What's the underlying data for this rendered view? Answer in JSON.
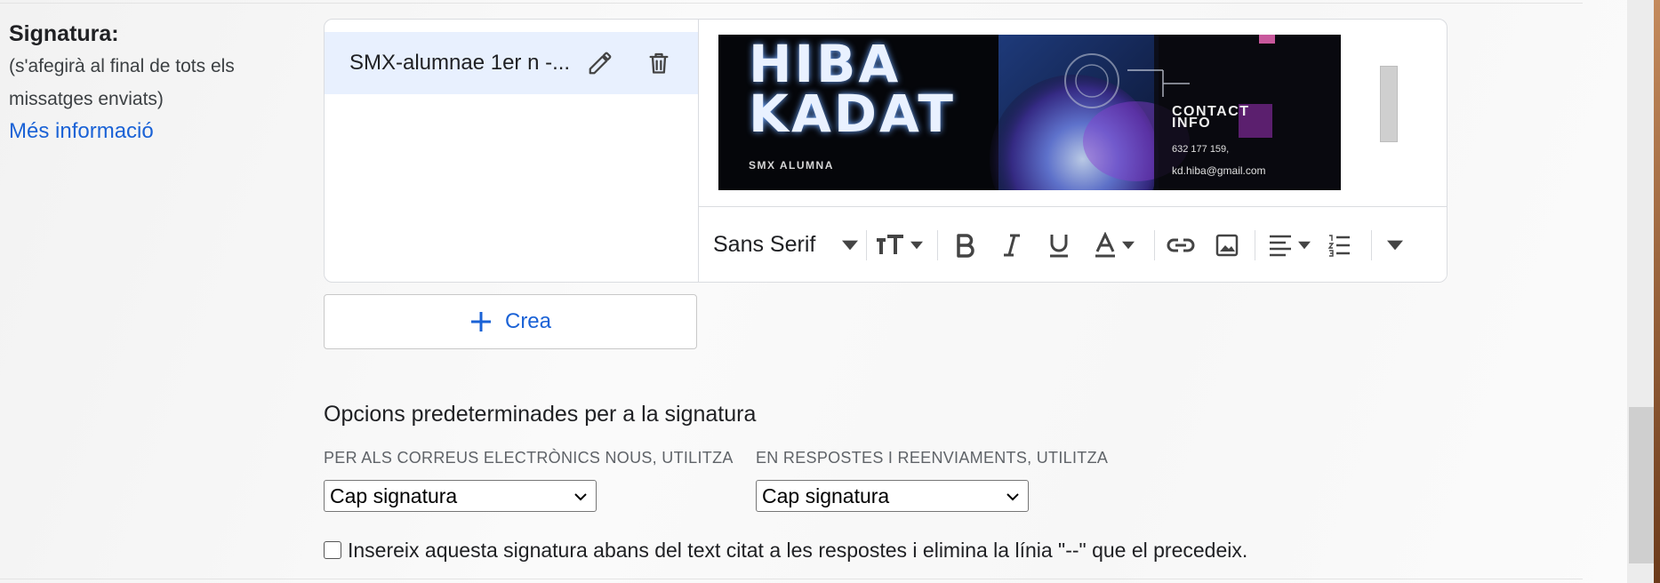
{
  "label": {
    "title": "Signatura:",
    "subtitle": "(s'afegirà al final de tots els missatges enviats)",
    "link": "Més informació"
  },
  "signatures": [
    {
      "name": "SMX-alumnae 1er n -...",
      "selected": true
    }
  ],
  "signature_image": {
    "name_line1": "HIBA",
    "name_line2": "KADAT",
    "role": "SMX ALUMNA",
    "contact_heading_1": "CONTACT",
    "contact_heading_2": "INFO",
    "phone": "632 177 159,",
    "email": "kd.hiba@gmail.com"
  },
  "toolbar": {
    "font": "Sans Serif",
    "bold_icon": "bold-icon",
    "italic_icon": "italic-icon",
    "underline_icon": "underline-icon"
  },
  "create_button": {
    "label": "Crea"
  },
  "defaults": {
    "title": "Opcions predeterminades per a la signatura",
    "new_emails_label": "PER ALS CORREUS ELECTRÒNICS NOUS, UTILITZA",
    "new_emails_value": "Cap signatura",
    "replies_label": "EN RESPOSTES I REENVIAMENTS, UTILITZA",
    "replies_value": "Cap signatura"
  },
  "insert_option": {
    "checked": false,
    "label": "Insereix aquesta signatura abans del text citat a les respostes i elimina la línia \"--\" que el precedeix."
  },
  "colors": {
    "link": "#1a62d6",
    "selected_bg": "#e8f0fe"
  }
}
